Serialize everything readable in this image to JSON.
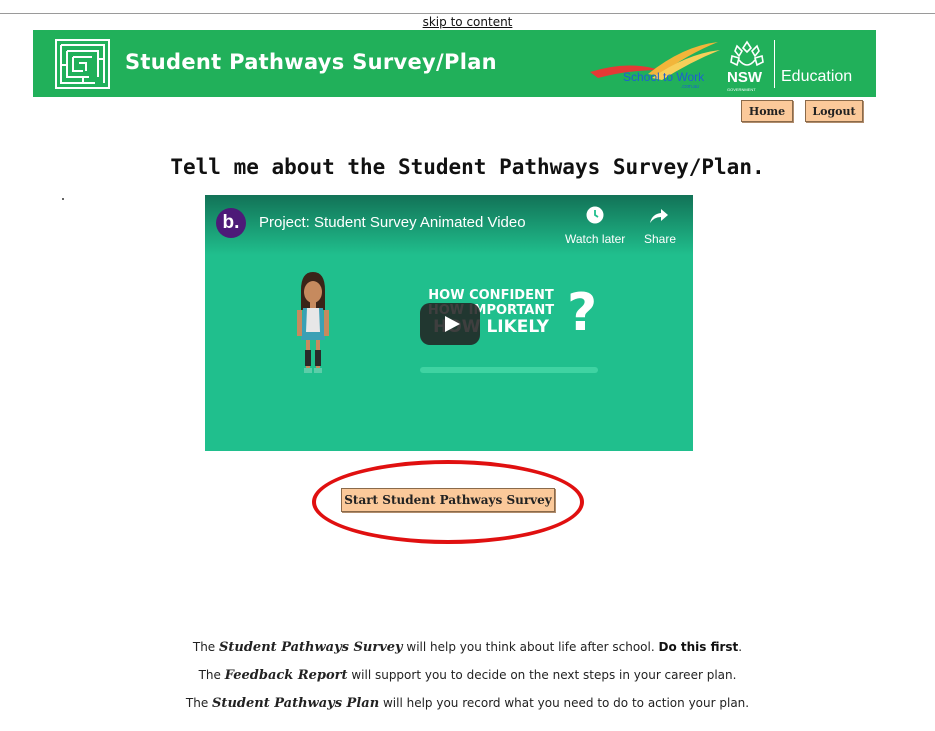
{
  "skip_link": "skip to content",
  "banner": {
    "title": "Student Pathways Survey/Plan",
    "school_to_work_text": "School to Work",
    "school_to_work_sub": ".com.au",
    "nsw_text": "NSW",
    "nsw_government": "GOVERNMENT",
    "education_text": "Education",
    "banner_color": "#21b05a"
  },
  "nav": {
    "home_label": "Home",
    "logout_label": "Logout"
  },
  "main": {
    "heading": "Tell me about the Student Pathways Survey/Plan."
  },
  "video": {
    "channel_letter": "b.",
    "title": "Project: Student Survey Animated Video",
    "watch_later_label": "Watch later",
    "share_label": "Share",
    "frame_lines": [
      "HOW CONFIDENT",
      "HOW IMPORTANT",
      "HOW LIKELY"
    ],
    "frame_symbol": "?",
    "background_color": "#20bf8d",
    "icons": [
      "clock-icon",
      "share-arrow-icon",
      "play-icon"
    ]
  },
  "start_button_label": "Start Student Pathways Survey",
  "info": {
    "line1": {
      "pre": "The ",
      "em": "Student Pathways Survey",
      "mid": " will help you think about life after school. ",
      "strong": "Do this first",
      "post": "."
    },
    "line2": {
      "pre": "The ",
      "em": "Feedback Report",
      "post": " will support you to decide on the next steps in your career plan."
    },
    "line3": {
      "pre": "The ",
      "em": "Student Pathways Plan",
      "post": " will help you record what you need to do to action your plan."
    }
  },
  "button_color": "#fbc99a",
  "highlight_color": "#e01010"
}
